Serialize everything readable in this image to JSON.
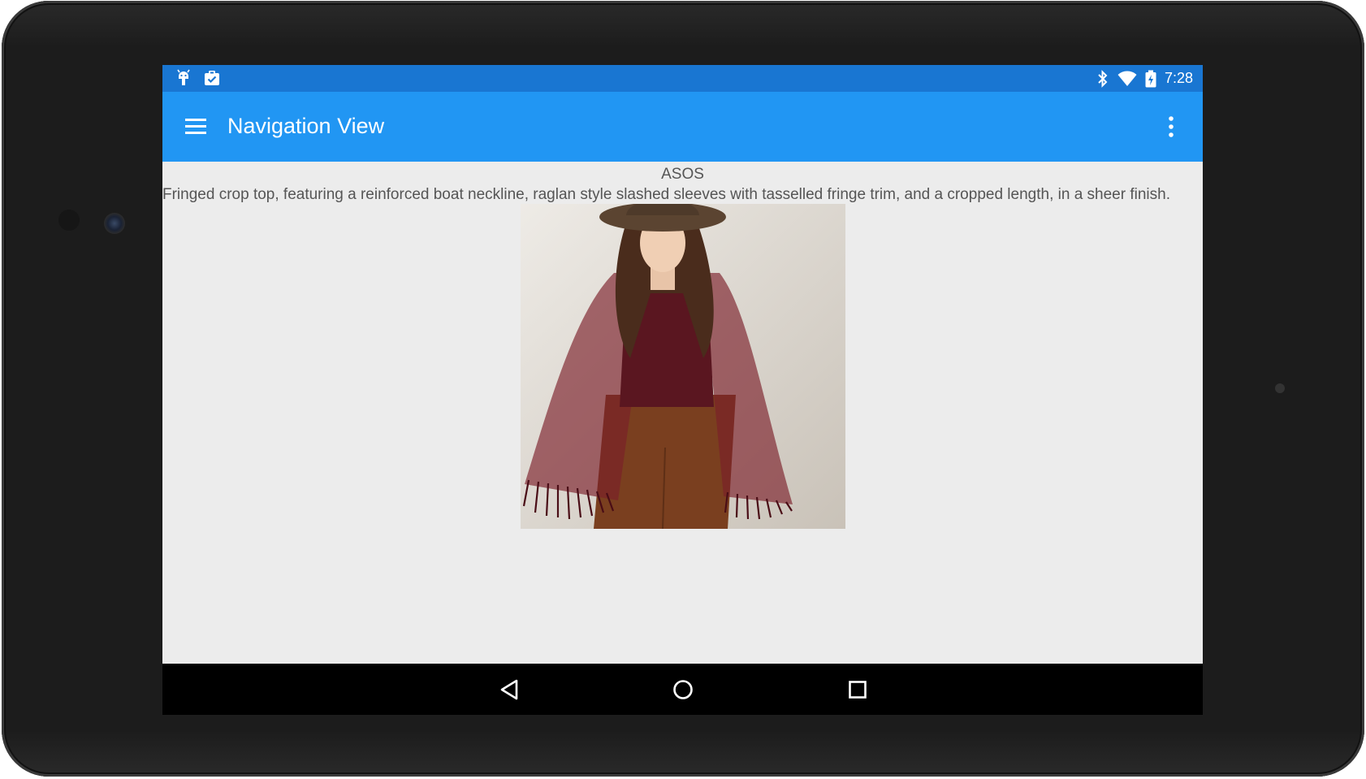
{
  "status_bar": {
    "time": "7:28",
    "left_icons": [
      "android-debug-icon",
      "clipboard-check-icon"
    ],
    "right_icons": [
      "bluetooth-icon",
      "wifi-icon",
      "battery-charging-icon"
    ],
    "color": "#1976d2"
  },
  "toolbar": {
    "title": "Navigation View",
    "menu_icon": "hamburger-menu-icon",
    "overflow_icon": "more-vertical-icon",
    "color": "#2196f3"
  },
  "product": {
    "brand": "ASOS",
    "description": "Fringed crop top, featuring a reinforced boat neckline, raglan style slashed sleeves with tasselled fringe trim, and a cropped length, in a sheer finish."
  },
  "nav_bar": {
    "buttons": [
      "back-icon",
      "home-icon",
      "recents-icon"
    ]
  }
}
